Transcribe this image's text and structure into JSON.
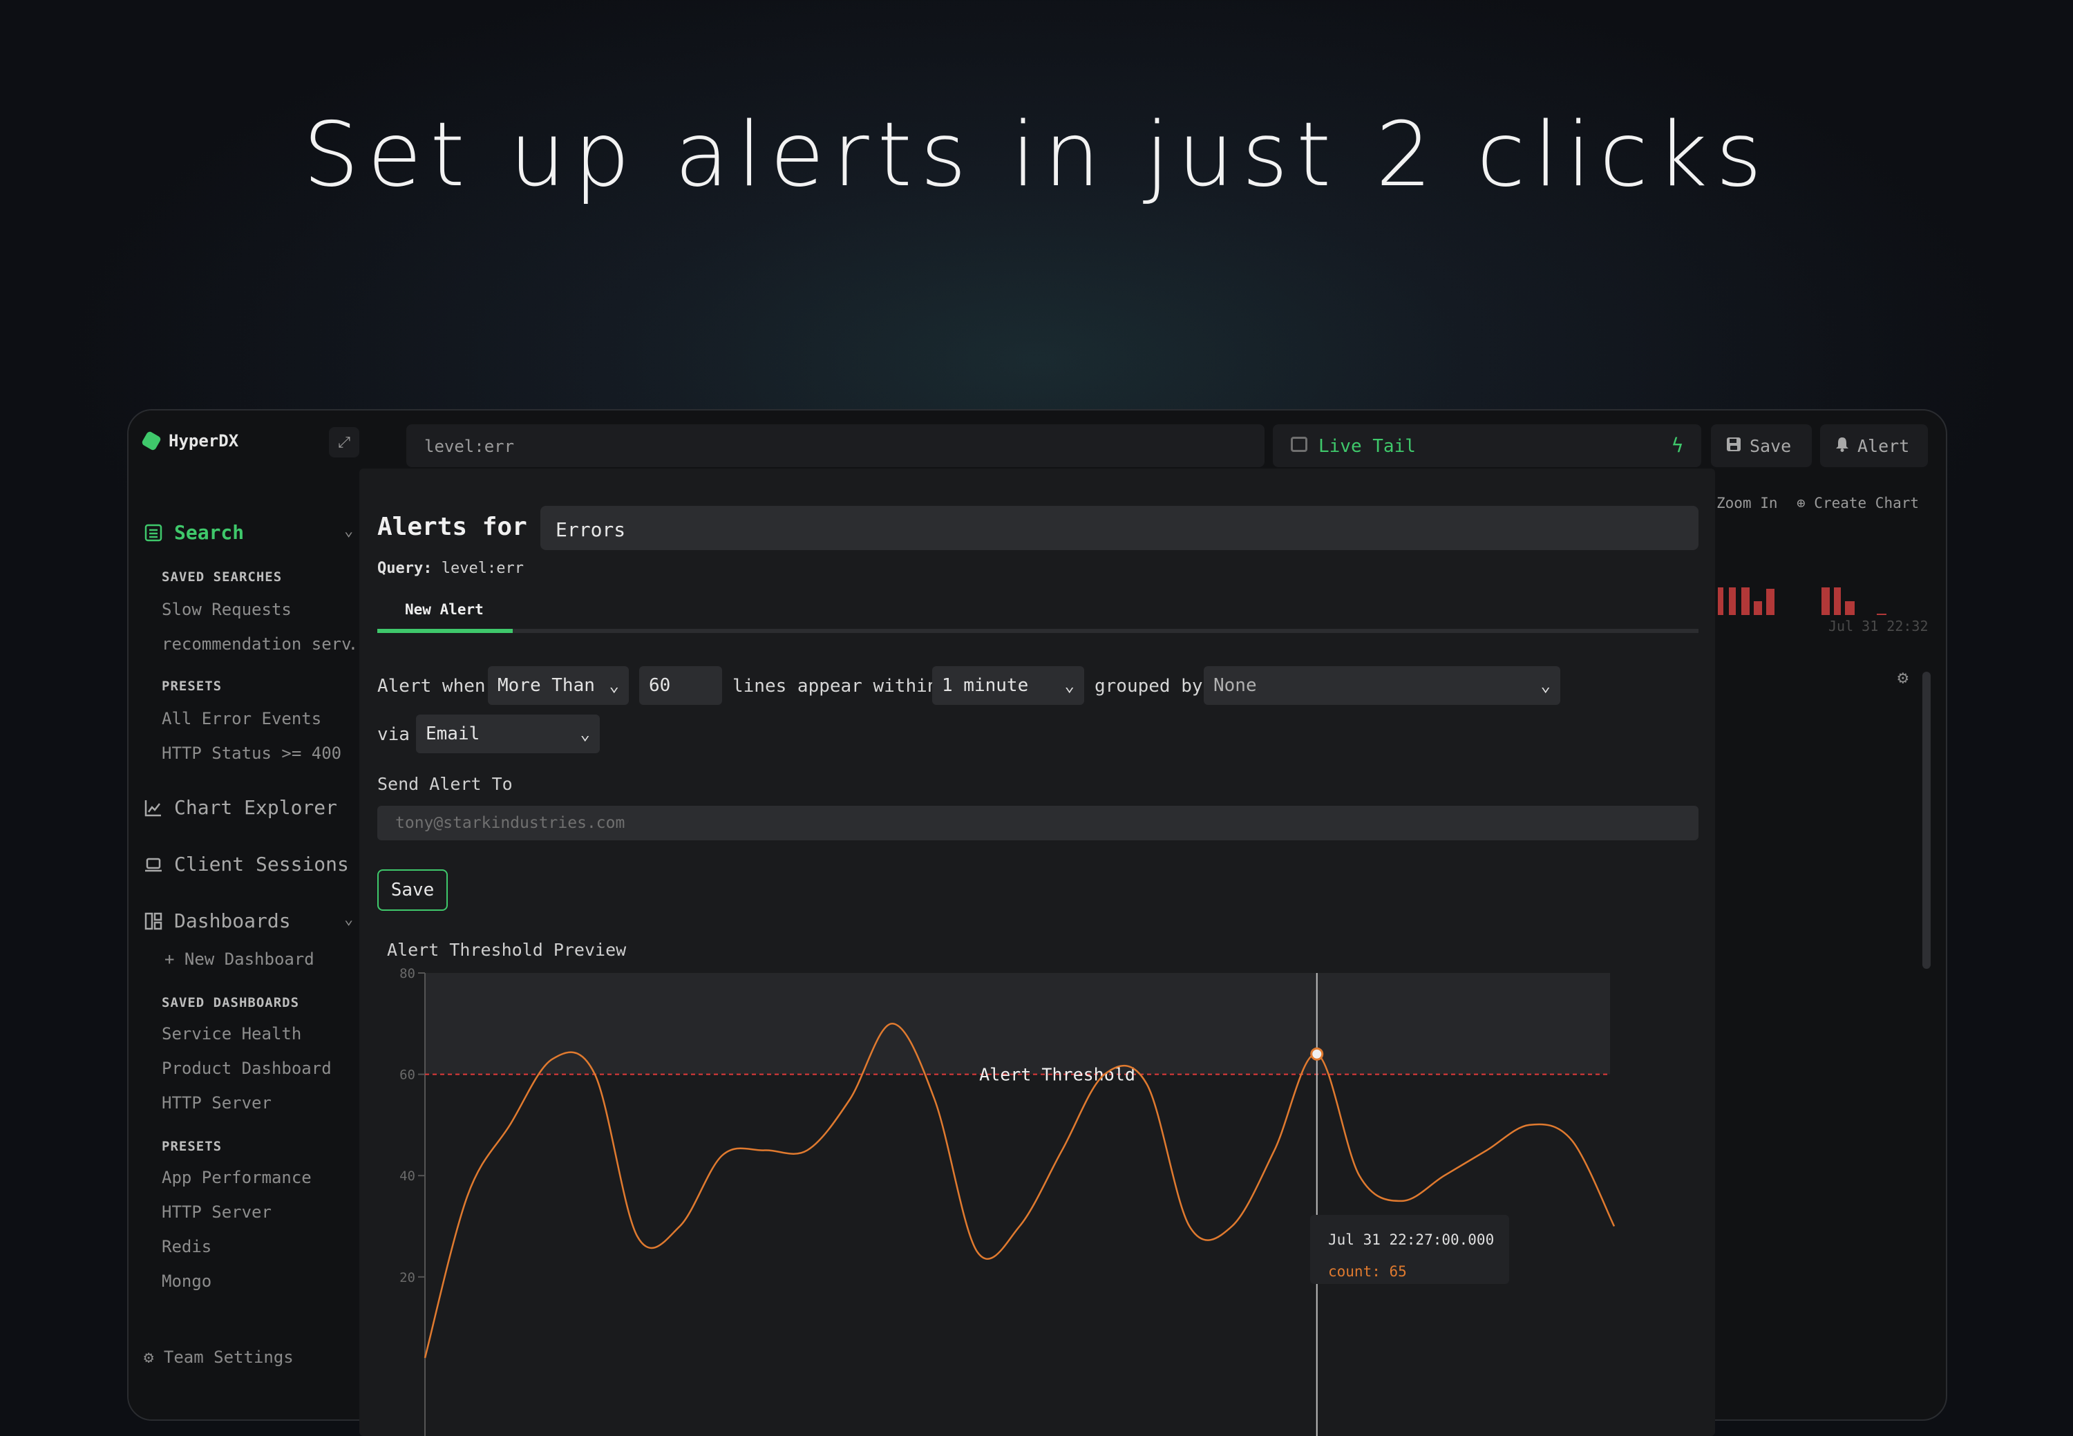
{
  "headline": "Set up alerts in just 2 clicks",
  "app": {
    "name": "HyperDX"
  },
  "sidebar": {
    "search_label": "Search",
    "saved_searches_heading": "SAVED SEARCHES",
    "saved_searches": [
      "Slow Requests",
      "recommendation serv…"
    ],
    "presets_heading": "PRESETS",
    "presets": [
      "All Error Events",
      "HTTP Status >= 400"
    ],
    "chart_explorer": "Chart Explorer",
    "client_sessions": "Client Sessions",
    "dashboards": "Dashboards",
    "new_dashboard": "New Dashboard",
    "saved_dashboards_heading": "SAVED DASHBOARDS",
    "saved_dashboards": [
      "Service Health",
      "Product Dashboard",
      "HTTP Server"
    ],
    "dashboard_presets_heading": "PRESETS",
    "dashboard_presets": [
      "App Performance",
      "HTTP Server",
      "Redis",
      "Mongo"
    ],
    "team_settings": "Team Settings"
  },
  "topbar": {
    "search_value": "level:err",
    "live_tail": "Live Tail",
    "save": "Save",
    "alert": "Alert",
    "zoom_in": "Zoom In",
    "create_chart": "Create Chart",
    "mini_chart_date": "Jul 31 22:32"
  },
  "colors": {
    "accent": "#3fc86b",
    "series": "#e07a2f",
    "threshold": "#e03a3a",
    "bars": "#b23838"
  },
  "modal": {
    "title": "Alerts for",
    "name_value": "Errors",
    "query_label": "Query:",
    "query_value": "level:err",
    "tab": "New Alert",
    "alert_when": "Alert when",
    "condition": "More Than",
    "threshold": "60",
    "lines_within": "lines appear within",
    "window": "1 minute",
    "grouped_by": "grouped by",
    "group_value": "None",
    "via": "via",
    "channel": "Email",
    "send_to_label": "Send Alert To",
    "send_to_placeholder": "tony@starkindustries.com",
    "save": "Save",
    "preview_title": "Alert Threshold Preview"
  },
  "chart_data": {
    "type": "line",
    "title": "Alert Threshold Preview",
    "y_ticks": [
      "80",
      "60",
      "40",
      "20"
    ],
    "ylim": [
      0,
      80
    ],
    "series": [
      {
        "values": [
          4,
          36,
          50,
          63,
          60,
          28,
          30,
          44,
          45,
          45,
          55,
          70,
          55,
          25,
          30,
          45,
          60,
          58,
          30,
          30,
          45,
          64,
          40,
          35,
          40,
          45,
          50,
          47,
          30
        ]
      }
    ],
    "threshold": {
      "value": 60,
      "label": "Alert Threshold"
    },
    "tooltip": {
      "time": "Jul 31 22:27:00.000",
      "count": "count: 65",
      "point_index": 21
    }
  }
}
